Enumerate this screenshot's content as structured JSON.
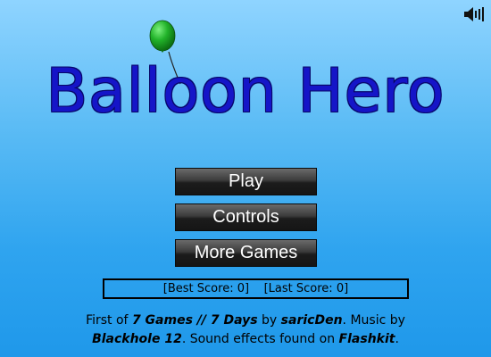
{
  "game": {
    "title": "Balloon Hero",
    "balloon_color": "#22b32a",
    "title_color": "#1515c8"
  },
  "sound": {
    "icon": "speaker-icon"
  },
  "menu": {
    "play_label": "Play",
    "controls_label": "Controls",
    "more_games_label": "More Games"
  },
  "scores": {
    "best_label": "[Best Score: ",
    "best_value": "0",
    "last_label": "[Last Score: ",
    "last_value": "0",
    "close_bracket": "]"
  },
  "credits": {
    "line1_prefix": "First of ",
    "series": "7 Games // 7 Days",
    "by": " by ",
    "author": "saricDen",
    "music_by": ". Music by",
    "musician": "Blackhole 12",
    "sfx_text": ". Sound effects found on ",
    "sfx_source": "Flashkit",
    "end": "."
  }
}
